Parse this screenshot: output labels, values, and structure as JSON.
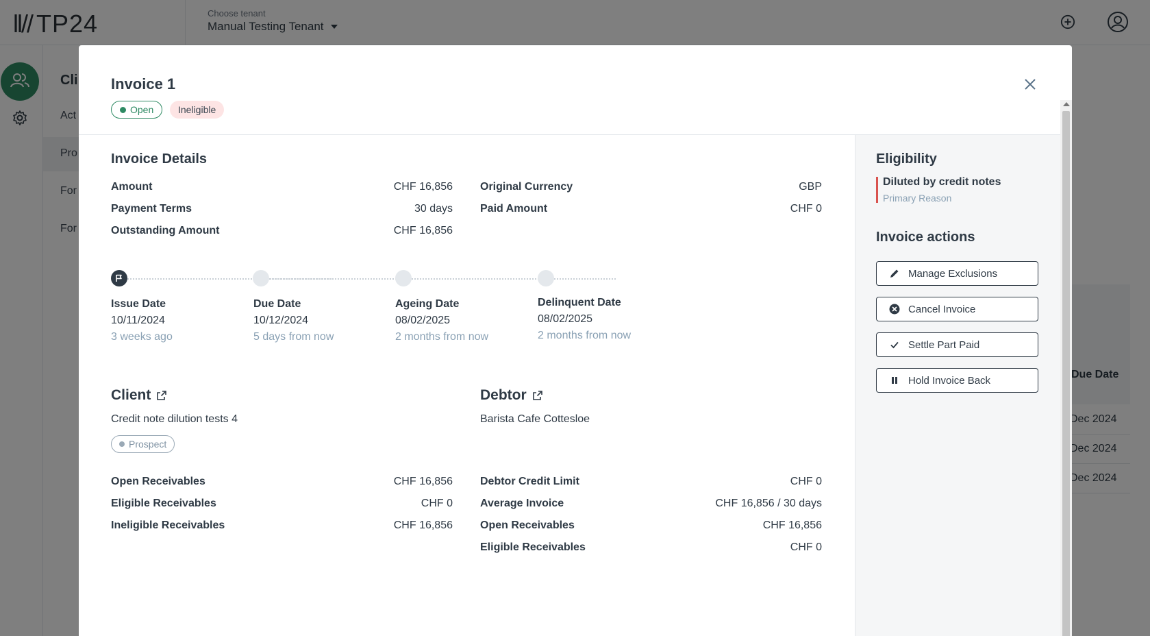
{
  "app": {
    "logo": "TP24",
    "tenant_label": "Choose tenant",
    "tenant_value": "Manual Testing Tenant"
  },
  "background": {
    "subnav_title": "Cli",
    "subnav_items": [
      "Act",
      "Pro",
      "For",
      "For"
    ],
    "table_header": "Due Date",
    "table_rows": [
      "Dec 2024",
      "Dec 2024",
      "Dec 2024"
    ]
  },
  "modal": {
    "title": "Invoice 1",
    "status_badge": "Open",
    "eligibility_badge": "Ineligible",
    "invoice_details": {
      "title": "Invoice Details",
      "left": [
        {
          "label": "Amount",
          "value": "CHF 16,856"
        },
        {
          "label": "Payment Terms",
          "value": "30 days"
        },
        {
          "label": "Outstanding Amount",
          "value": "CHF 16,856"
        }
      ],
      "right": [
        {
          "label": "Original Currency",
          "value": "GBP"
        },
        {
          "label": "Paid Amount",
          "value": "CHF 0"
        }
      ]
    },
    "timeline": [
      {
        "label": "Issue Date",
        "date": "10/11/2024",
        "relative": "3 weeks ago"
      },
      {
        "label": "Due Date",
        "date": "10/12/2024",
        "relative": "5 days from now"
      },
      {
        "label": "Ageing Date",
        "date": "08/02/2025",
        "relative": "2 months from now"
      },
      {
        "label": "Delinquent Date",
        "date": "08/02/2025",
        "relative": "2 months from now"
      }
    ],
    "client": {
      "title": "Client",
      "name": "Credit note dilution tests 4",
      "badge": "Prospect",
      "stats": [
        {
          "label": "Open Receivables",
          "value": "CHF 16,856"
        },
        {
          "label": "Eligible Receivables",
          "value": "CHF 0"
        },
        {
          "label": "Ineligible Receivables",
          "value": "CHF 16,856"
        }
      ]
    },
    "debtor": {
      "title": "Debtor",
      "name": "Barista Cafe Cottesloe",
      "stats": [
        {
          "label": "Debtor Credit Limit",
          "value": "CHF 0"
        },
        {
          "label": "Average Invoice",
          "value": "CHF 16,856 / 30 days"
        },
        {
          "label": "Open Receivables",
          "value": "CHF 16,856"
        },
        {
          "label": "Eligible Receivables",
          "value": "CHF 0"
        }
      ]
    },
    "eligibility": {
      "title": "Eligibility",
      "reason": "Diluted by credit notes",
      "reason_sub": "Primary Reason"
    },
    "actions": {
      "title": "Invoice actions",
      "buttons": [
        "Manage Exclusions",
        "Cancel Invoice",
        "Settle Part Paid",
        "Hold Invoice Back"
      ]
    }
  },
  "colors": {
    "brand_green": "#2e8a63",
    "ineligible_bg": "#fde4e4",
    "reason_red": "#d9534f",
    "muted_blue": "#8aa1b4"
  }
}
